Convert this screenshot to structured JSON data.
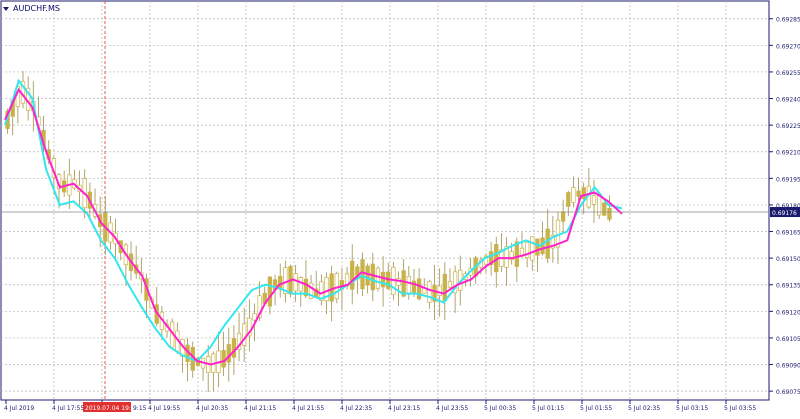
{
  "window": {
    "symbol_title": "AUDCHF.MS",
    "menu_icon": "triangle-down-icon"
  },
  "colors": {
    "background": "#ffffff",
    "frame": "#1b1b6e",
    "grid": "#b8b8b8",
    "axis_text": "#1b1b6e",
    "candle": "#c9b24a",
    "candle_dark": "#9c8f4a",
    "ma_fast": "#ff22cc",
    "ma_slow": "#33e6f0",
    "price_marker_bg": "#1b1b6e",
    "price_marker_text": "#ffffff",
    "cursor_line": "#e03030",
    "time_marker_bg": "#e03030",
    "time_marker_text": "#ffffff"
  },
  "price_axis": {
    "labels": [
      "0.69285",
      "0.69270",
      "0.69255",
      "0.69240",
      "0.69225",
      "0.69210",
      "0.69195",
      "0.69180",
      "0.69165",
      "0.69150",
      "0.69135",
      "0.69120",
      "0.69105",
      "0.69090",
      "0.69075"
    ],
    "current_price": "0.69176"
  },
  "time_axis": {
    "labels": [
      "4 Jul 2019",
      "4 Jul 17:55",
      "4",
      "4 Jul 19:55",
      "4 Jul 20:35",
      "4 Jul 21:15",
      "4 Jul 21:55",
      "4 Jul 22:35",
      "4 Jul 23:15",
      "4 Jul 23:55",
      "5 Jul 00:35",
      "5 Jul 01:15",
      "5 Jul 01:55",
      "5 Jul 02:35",
      "5 Jul 03:15",
      "5 Jul 03:55"
    ],
    "highlighted_time": "2019.07.04 19:00",
    "highlighted_suffix": "9:15"
  },
  "chart_data": {
    "type": "candlestick",
    "ylim": [
      0.6907,
      0.69295
    ],
    "ma_fast_values": [
      0.69228,
      0.69245,
      0.69235,
      0.6921,
      0.6919,
      0.69192,
      0.69185,
      0.6917,
      0.69162,
      0.6915,
      0.6914,
      0.6912,
      0.6911,
      0.691,
      0.69092,
      0.6909,
      0.69092,
      0.691,
      0.6911,
      0.69125,
      0.69135,
      0.69138,
      0.69135,
      0.6913,
      0.69133,
      0.69135,
      0.69142,
      0.6914,
      0.69138,
      0.69137,
      0.69135,
      0.69132,
      0.6913,
      0.69135,
      0.69138,
      0.69145,
      0.6915,
      0.6915,
      0.69152,
      0.69155,
      0.69157,
      0.6916,
      0.69185,
      0.69187,
      0.69182,
      0.69175
    ],
    "ma_slow_values": [
      0.69225,
      0.6925,
      0.6924,
      0.692,
      0.6918,
      0.69182,
      0.69175,
      0.6916,
      0.6915,
      0.69135,
      0.69122,
      0.6911,
      0.691,
      0.69095,
      0.69092,
      0.691,
      0.69112,
      0.69122,
      0.69132,
      0.69135,
      0.69133,
      0.6913,
      0.6913,
      0.69127,
      0.6913,
      0.69135,
      0.6914,
      0.69137,
      0.69135,
      0.6913,
      0.6913,
      0.69128,
      0.69125,
      0.69135,
      0.69143,
      0.6915,
      0.69153,
      0.69157,
      0.6916,
      0.69157,
      0.69162,
      0.69165,
      0.6918,
      0.6919,
      0.6918,
      0.69178
    ]
  }
}
